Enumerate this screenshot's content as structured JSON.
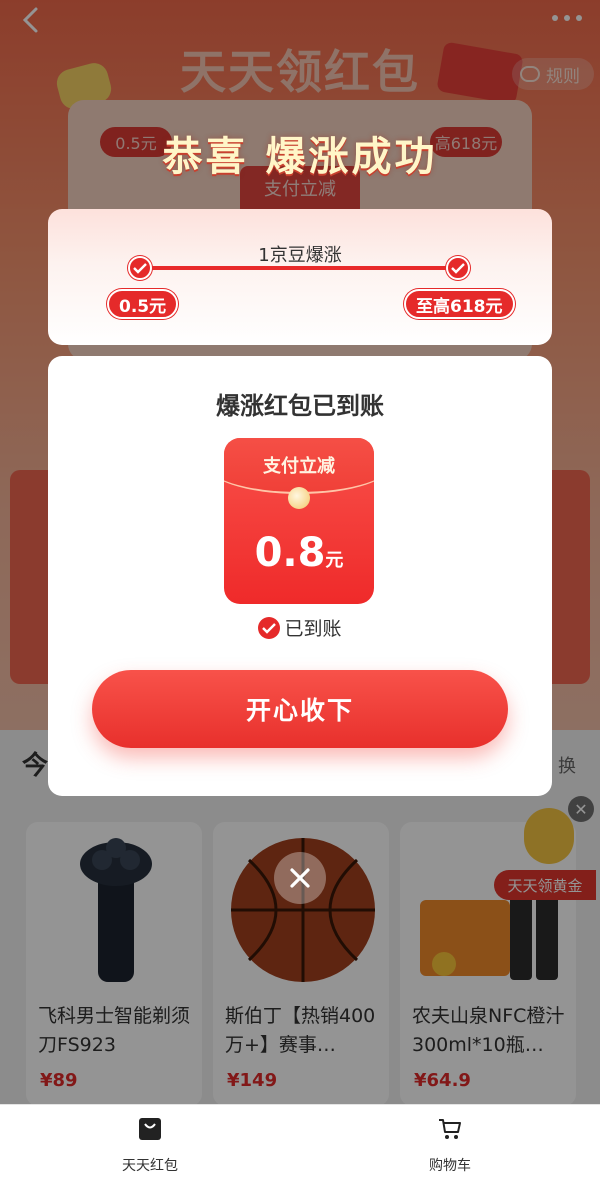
{
  "background": {
    "banner_title": "天天领红包",
    "rules_label": "规则",
    "min_value": "0.5元",
    "max_value": "至高618元",
    "tab_label": "支付立减",
    "section_title": "今",
    "section_swap": "换"
  },
  "popup": {
    "headline": "恭喜 爆涨成功",
    "progress_label": "1京豆爆涨",
    "start_value": "0.5元",
    "end_value": "至高618元",
    "card_title": "爆涨红包已到账",
    "envelope_label": "支付立减",
    "amount": "0.8",
    "amount_unit": "元",
    "received_label": "已到账",
    "accept_button": "开心收下"
  },
  "products": [
    {
      "name": "飞科男士智能剃须刀FS923",
      "price": "¥89"
    },
    {
      "name": "斯伯丁【热销400万+】赛事…",
      "price": "¥149"
    },
    {
      "name": "农夫山泉NFC橙汁300ml*10瓶…",
      "price": "¥64.9"
    }
  ],
  "floating_tag": "天天领黄金",
  "tabbar": {
    "items": [
      {
        "label": "天天红包",
        "icon": "red-packet-icon"
      },
      {
        "label": "购物车",
        "icon": "cart-icon"
      }
    ]
  },
  "colors": {
    "accent_red": "#E52A2A",
    "headline_yellow": "#FFF6C8"
  }
}
